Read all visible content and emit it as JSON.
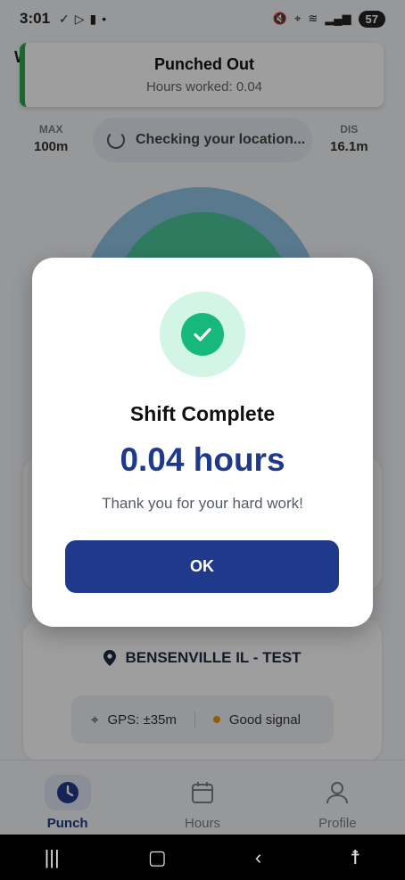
{
  "status_bar": {
    "time": "3:01",
    "battery": "57"
  },
  "toast": {
    "title": "Punched Out",
    "subtitle": "Hours worked: 0.04"
  },
  "header": {
    "partial_letter": "W"
  },
  "stats": {
    "max_label": "MAX",
    "max_value": "100m",
    "dis_label": "DIS",
    "dis_value": "16.1m",
    "checking_text": "Checking your location..."
  },
  "location_card": {
    "name": "BENSENVILLE IL - TEST",
    "gps": "GPS: ±35m",
    "signal": "Good signal"
  },
  "bottom_nav": {
    "items": [
      {
        "label": "Punch",
        "icon": "clock-icon",
        "active": true
      },
      {
        "label": "Hours",
        "icon": "calendar-icon",
        "active": false
      },
      {
        "label": "Profile",
        "icon": "person-icon",
        "active": false
      }
    ]
  },
  "modal": {
    "title": "Shift Complete",
    "hours": "0.04 hours",
    "message": "Thank you for your hard work!",
    "ok_label": "OK"
  },
  "colors": {
    "primary": "#1f3a8a",
    "success": "#16b97a",
    "signal": "#e69a0c"
  }
}
